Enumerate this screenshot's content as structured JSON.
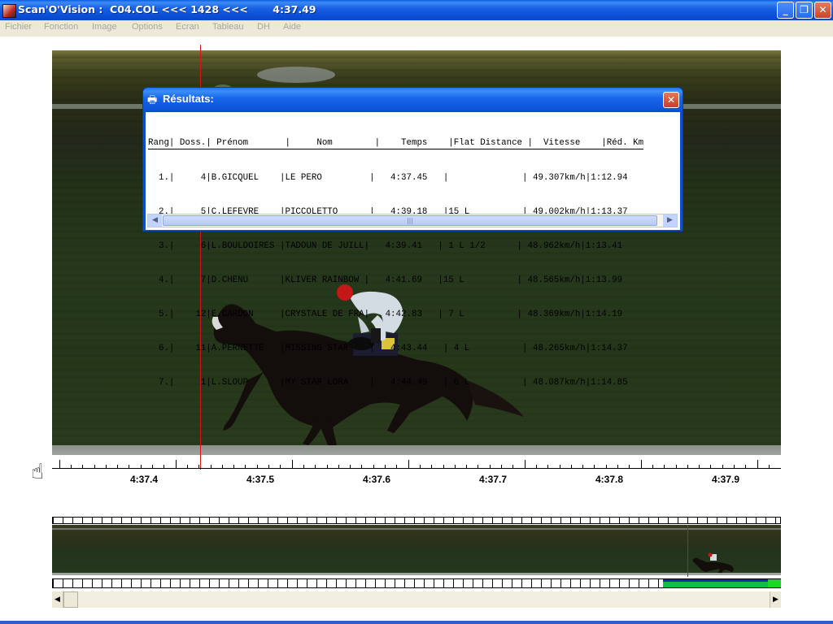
{
  "window": {
    "title": "Scan'O'Vision :  C04.COL <<< 1428 <<<       4:37.49",
    "buttons": {
      "minimize": "_",
      "restore": "❐",
      "close": "✕"
    }
  },
  "menu": [
    "Fichier",
    "Fonction",
    "Image",
    "Options",
    "Ecran",
    "Tableau",
    "DH",
    "Aide"
  ],
  "time_ruler": {
    "labels": [
      "4:37.4",
      "4:37.5",
      "4:37.6",
      "4:37.7",
      "4:37.8",
      "4:37.9"
    ]
  },
  "results_dialog": {
    "title": "Résultats:",
    "header": "Rang| Doss.| Prénom       |     Nom        |    Temps    |Flat Distance |  Vitesse    |Réd. Km",
    "rows": [
      "  1.|     4|B.GICQUEL    |LE PERO         |   4:37.45   |              | 49.307km/h|1:12.94",
      "  2.|     5|C.LEFEVRE    |PICCOLETTO      |   4:39.18   |15 L          | 49.002km/h|1:13.37",
      "  3.|     6|L.BOULDOIRES |TADOUN DE JUILL|   4:39.41   | 1 L 1/2      | 48.962km/h|1:13.41",
      "  4.|     7|D.CHENU      |KLIVER RAINBOW |   4:41.69   |15 L          | 48.565km/h|1:13.99",
      "  5.|    12|E.CARDON     |CRYSTALE DE FRA|   4:42.83   | 7 L          | 48.369km/h|1:14.19",
      "  6.|    11|A.PERNETTE   |MISSING STAR    |   4:43.44   | 4 L          | 48.265km/h|1:14.37",
      "  7.|     1|L.SLOUP      |MY STAR LORA    |   4:44.49   | 6 L          | 48.087km/h|1:14.85"
    ]
  },
  "icons": {
    "app": "app-icon",
    "print": "printer-icon",
    "hand": "pointing-hand-icon"
  },
  "colors": {
    "finish_line": "#e01010",
    "title_blue": "#0a53d8",
    "viewport_green": "#11c03a"
  }
}
